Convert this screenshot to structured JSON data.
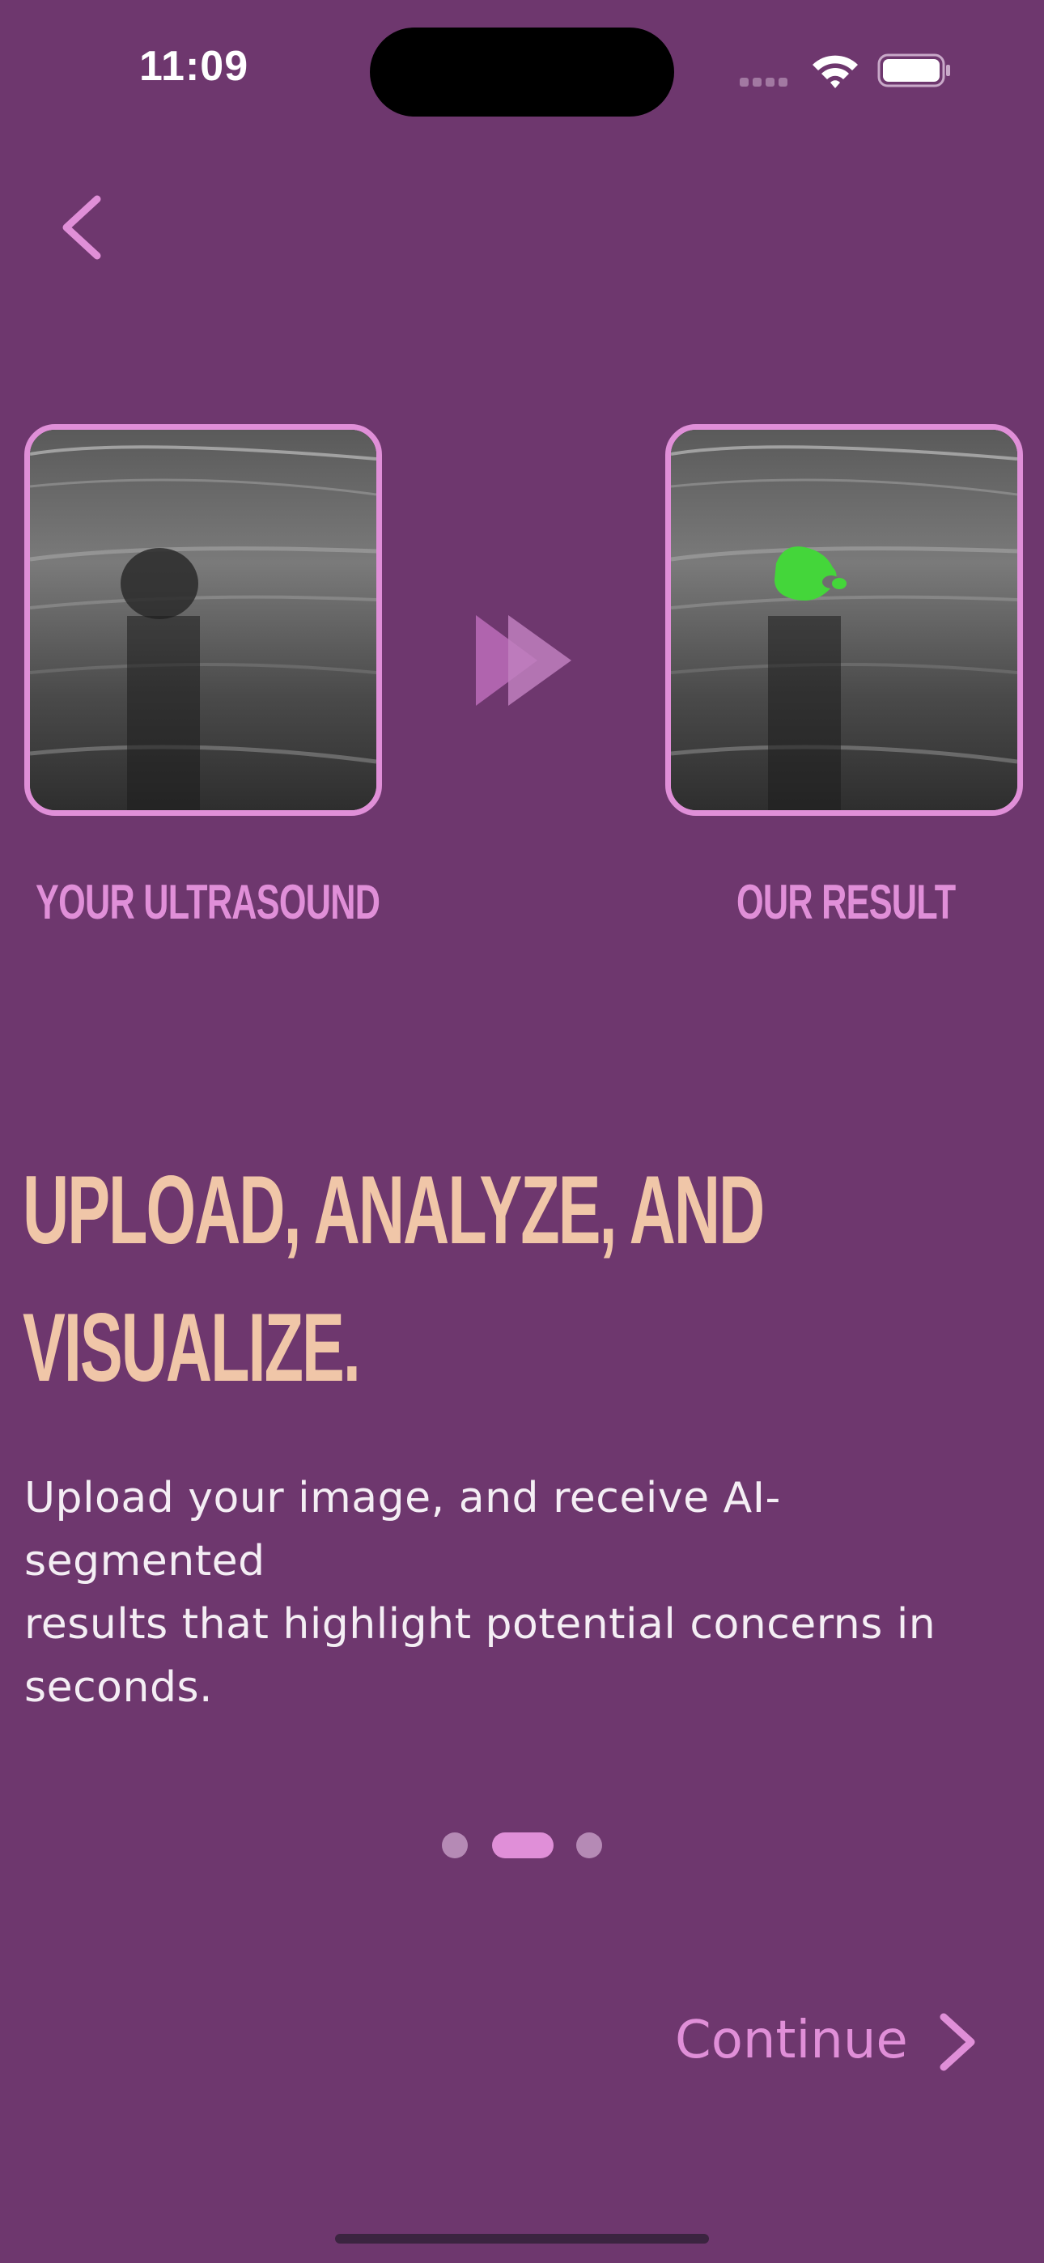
{
  "status_bar": {
    "time": "11:09"
  },
  "images": {
    "left_caption": "YOUR ULTRASOUND",
    "right_caption": "OUR RESULT"
  },
  "headline": {
    "line1": "UPLOAD, ANALYZE, AND",
    "line2": "VISUALIZE."
  },
  "body": {
    "line1": "Upload your image, and receive AI-segmented",
    "line2": "results that highlight potential concerns in",
    "line3": "seconds."
  },
  "pager": {
    "page_count": 3,
    "current_page": 2
  },
  "continue_label": "Continue",
  "colors": {
    "background": "#6e376e",
    "accent": "#e08fd8",
    "headline": "#f0c6a8",
    "segmentation": "#44d63a"
  }
}
